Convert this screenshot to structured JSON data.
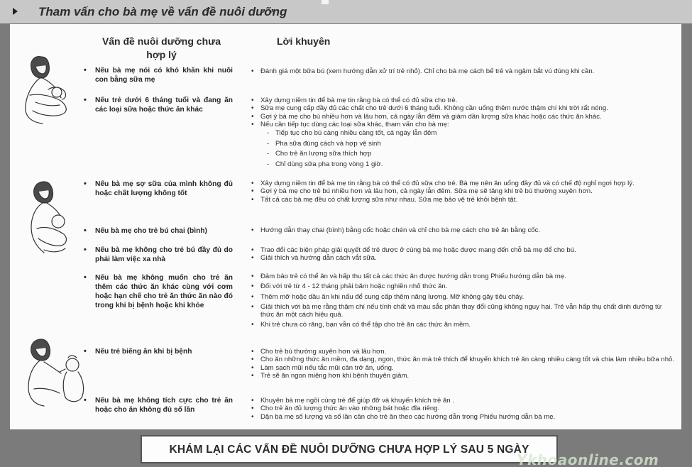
{
  "header": {
    "title": "Tham vấn cho bà mẹ về vấn đề nuôi dưỡng"
  },
  "columns": {
    "problems": "Vấn đề nuôi dưỡng chưa hợp lý",
    "advice": "Lời khuyên"
  },
  "icons": {
    "header_marker": "triangle-right-icon"
  },
  "rows": [
    {
      "problem": "Nếu bà mẹ nói có khó khăn khi nuôi con bằng sữa mẹ",
      "advice": [
        "Đánh giá một bữa bú (xem hướng dẫn xử trí trẻ nhỏ). Chỉ cho bà mẹ cách bế trẻ và ngậm bắt vú đúng khi cần."
      ]
    },
    {
      "problem": "Nếu trẻ dưới 6 tháng tuổi và đang ăn các loại sữa hoặc thức ăn khác",
      "advice": [
        "Xây dựng niềm tin để bà mẹ tin rằng bà có thể có đủ sữa cho trẻ.",
        "Sữa mẹ cung cấp đầy đủ các chất cho trẻ dưới 6 tháng tuổi. Không cần uống thêm nước thậm chí khi trời rất nóng.",
        "Gợi ý bà mẹ cho bú nhiều hơn và lâu hơn, cả ngày lẫn đêm và giảm dần lượng sữa khác hoặc các thức ăn khác.",
        "Nếu cần tiếp tục dùng các loại sữa khác, tham vấn cho bà mẹ:"
      ],
      "subitems": [
        "Tiếp tục cho bú càng nhiều càng tốt, cả ngày lẫn đêm",
        "Pha sữa đúng cách và hợp vệ sinh",
        "Cho trẻ ăn lượng sữa thích hợp",
        "Chỉ dùng sữa pha trong vòng 1 giờ."
      ]
    },
    {
      "problem": "Nếu bà mẹ sợ sữa của mình không đủ hoặc chất lượng không tốt",
      "advice": [
        "Xây dựng niềm tin để bà mẹ tin rằng bà có thể có đủ sữa cho trẻ. Bà mẹ nên ăn uống đầy đủ và có chế độ nghỉ ngơi hợp lý.",
        "Gợi ý bà mẹ cho trẻ bú nhiều hơn và lâu hơn, cả ngày lẫn đêm. Sữa mẹ sẽ tăng khi trẻ bú thường xuyên hơn.",
        "Tất cả các bà mẹ đều có chất lượng sữa như nhau. Sữa mẹ bảo vệ trẻ khỏi bệnh tật."
      ]
    },
    {
      "problem": "Nếu bà mẹ cho trẻ bú chai (bình)",
      "advice": [
        "Hướng dẫn thay chai (bình) bằng cốc hoặc chén và chỉ cho bà mẹ cách cho trẻ ăn bằng cốc."
      ]
    },
    {
      "problem": "Nếu bà mẹ không cho trẻ bú đầy đủ do phải làm việc xa nhà",
      "advice": [
        "Trao đổi các biện pháp giải quyết để trẻ được ở cùng bà mẹ hoặc được mang đến chỗ bà mẹ để cho bú.",
        "Giải thích và hướng dẫn cách vắt sữa."
      ]
    },
    {
      "problem": "Nếu bà mẹ không muốn cho trẻ ăn thêm các thức ăn khác cùng với cơm hoặc hạn chế cho trẻ ăn thức ăn nào đó trong khi bị bệnh hoặc khi khỏe",
      "advice": [
        "Đảm bảo trẻ có thể ăn và hấp thu tất cả các thức ăn được hướng dẫn trong Phiếu hướng dẫn bà mẹ.",
        "Đối với trẻ từ 4 - 12 tháng phải băm hoặc nghiền nhỏ thức ăn.",
        "Thêm mỡ hoặc dầu ăn khi nấu để cung cấp thêm năng lượng. Mỡ không gây tiêu chảy.",
        "Giải thích với bà mẹ rằng thậm chí nếu tính chất và màu sắc phân thay đổi cũng không nguy hại. Trẻ vẫn hấp thụ chất dinh dưỡng từ thức ăn một cách hiệu quả.",
        "Khi trẻ chưa có răng, bạn vẫn có thể tập cho trẻ ăn các thức ăn mềm."
      ]
    },
    {
      "problem": "Nếu trẻ biếng ăn khi bị bệnh",
      "advice": [
        "Cho trẻ bú thường xuyên hơn và lâu hơn.",
        "Cho ăn những thức ăn mềm, đa dạng, ngon, thức ăn mà trẻ thích để khuyến khích trẻ ăn càng nhiều càng tốt và chia làm nhiều bữa nhỏ.",
        "Làm sạch mũi nếu tắc mũi cản trở ăn, uống.",
        "Trẻ sẽ ăn ngon miệng hơn khi bệnh thuyên giảm."
      ]
    },
    {
      "problem": "Nếu bà mẹ không tích cực cho trẻ ăn hoặc cho ăn không đủ số lần",
      "advice": [
        "Khuyên bà mẹ ngồi cùng trẻ để giúp đỡ và khuyến khích trẻ ăn .",
        "Cho trẻ ăn đủ lượng thức ăn vào những bát hoặc đĩa riêng.",
        "Dặn bà mẹ số lượng và số lần cần cho trẻ ăn theo các hướng dẫn trong Phiếu hướng dẫn  bà mẹ."
      ]
    }
  ],
  "footer": "KHÁM LẠI CÁC VẤN ĐỀ NUÔI DƯỠNG CHƯA HỢP LÝ SAU 5 NGÀY",
  "watermark": "Ykhoaonline.com"
}
